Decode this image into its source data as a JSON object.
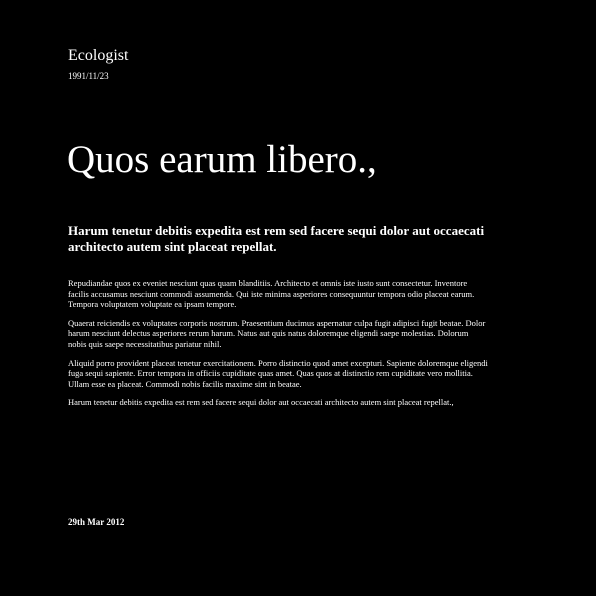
{
  "masthead": {
    "publication": "Ecologist",
    "date": "1991/11/23"
  },
  "article": {
    "headline": "Quos earum libero.,",
    "standfirst": "Harum tenetur debitis expedita est rem sed facere sequi dolor aut occaecati architecto autem sint placeat repellat.",
    "paragraphs": [
      "Repudiandae quos ex eveniet nesciunt quas quam blanditiis. Architecto et omnis iste iusto sunt consectetur. Inventore facilis accusamus nesciunt commodi assumenda. Qui iste minima asperiores consequuntur tempora odio placeat earum. Tempora voluptatem voluptate ea ipsam tempore.",
      "Quaerat reiciendis ex voluptates corporis nostrum. Praesentium ducimus aspernatur culpa fugit adipisci fugit beatae. Dolor harum nesciunt delectus asperiores rerum harum. Natus aut quis natus doloremque eligendi saepe molestias. Dolorum nobis quis saepe necessitatibus pariatur nihil.",
      "Aliquid porro provident placeat tenetur exercitationem. Porro distinctio quod amet excepturi. Sapiente doloremque eligendi fuga sequi sapiente. Error tempora in officiis cupiditate quas amet. Quas quos at distinctio rem cupiditate vero mollitia. Ullam esse ea placeat. Commodi nobis facilis maxime sint in beatae.",
      "Harum tenetur debitis expedita est rem sed facere sequi dolor aut occaecati architecto autem sint placeat repellat.,"
    ],
    "footer_date": "29th Mar 2012"
  },
  "colors": {
    "background": "#000000",
    "text": "#ffffff"
  }
}
